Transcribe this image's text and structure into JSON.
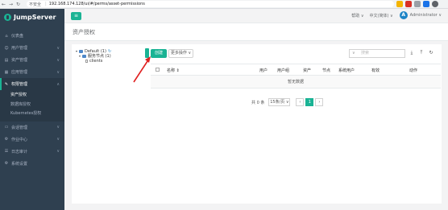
{
  "browser": {
    "url_warning": "不安全",
    "url": "192.168.174.128/ui/#/perms/asset-permissions",
    "back": "←",
    "forward": "→",
    "reload": "↻"
  },
  "sidebar": {
    "brand": "JumpServer",
    "items": [
      {
        "label": "仪表盘",
        "icon": "dashboard-icon",
        "glyph": "⌂"
      },
      {
        "label": "用户管理",
        "icon": "users-icon",
        "glyph": "☺"
      },
      {
        "label": "资产管理",
        "icon": "assets-icon",
        "glyph": "▤"
      },
      {
        "label": "应用管理",
        "icon": "apps-icon",
        "glyph": "▦"
      },
      {
        "label": "权限管理",
        "icon": "permissions-icon",
        "glyph": "✎"
      }
    ],
    "submenu": [
      {
        "label": "资产授权"
      },
      {
        "label": "数据库授权"
      },
      {
        "label": "Kubernetes授权"
      }
    ],
    "items_after": [
      {
        "label": "会话管理",
        "icon": "sessions-icon",
        "glyph": "▭"
      },
      {
        "label": "作业中心",
        "icon": "jobs-icon",
        "glyph": "⚙"
      },
      {
        "label": "日志审计",
        "icon": "audit-icon",
        "glyph": "☰"
      },
      {
        "label": "系统设置",
        "icon": "settings-icon",
        "glyph": "⚙"
      }
    ]
  },
  "topbar": {
    "help": "帮助 ∨",
    "language": "中文(简体) ∨",
    "avatar_letter": "A",
    "user": "Administrator ∨"
  },
  "page": {
    "title": "资产授权"
  },
  "tree": {
    "root": "Default (1)",
    "child": "服务节点 (1)",
    "leaf": "clients"
  },
  "toolbar": {
    "create": "创建",
    "batch": "更多操作 ∨",
    "search_placeholder": "搜索"
  },
  "table": {
    "columns": [
      "名称 ⇕",
      "用户",
      "用户组",
      "资产",
      "节点",
      "系统用户",
      "有效",
      "动作"
    ],
    "empty_text": "暂无数据"
  },
  "pagination": {
    "total": "共 0 条",
    "page_size": "15条/页 ∨",
    "prev": "‹",
    "current": "1",
    "next": "›"
  },
  "colors": {
    "sidebar": "#2f4050",
    "accent": "#1ab394",
    "annotation": "#e02020"
  }
}
